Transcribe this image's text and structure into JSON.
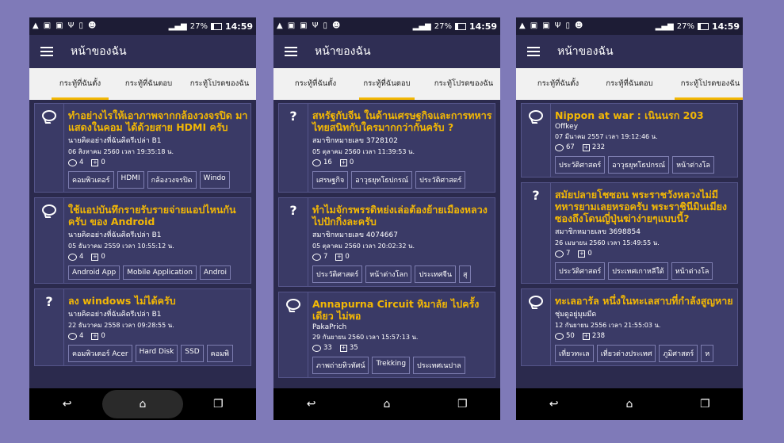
{
  "status": {
    "battery": "27%",
    "time": "14:59"
  },
  "app": {
    "title": "หน้าของฉัน"
  },
  "tabs": [
    "กระทู้ที่ฉันตั้ง",
    "กระทู้ที่ฉันตอบ",
    "กระทู้โปรดของฉัน"
  ],
  "phones": [
    {
      "active_tab": 0,
      "cards": [
        {
          "icon": "comment",
          "title": "ทำอย่างไรให้เอาภาพจากกล้องวงจรปิด มาแสดงในคอม ได้ด้วยสาย HDMI ครับ",
          "author": "นายคิดอย่างที่ฉันคิดรีเปล่า B1",
          "date": "06 สิงหาคม 2560 เวลา 19:35:18 น.",
          "comments": "4",
          "plus": "0",
          "tags": [
            "คอมพิวเตอร์",
            "HDMI",
            "กล้องวงจรปิด",
            "Windo"
          ]
        },
        {
          "icon": "comment",
          "title": "ใช้แอปบันทึกรายรับรายจ่ายแอปไหนกันครับ ของ Android",
          "author": "นายคิดอย่างที่ฉันคิดรีเปล่า B1",
          "date": "05 ธันวาคม 2559 เวลา 10:55:12 น.",
          "comments": "4",
          "plus": "0",
          "tags": [
            "Android App",
            "Mobile Application",
            "Androi"
          ]
        },
        {
          "icon": "question",
          "title": "ลง windows ไม่ได้ครับ",
          "author": "นายคิดอย่างที่ฉันคิดรีเปล่า B1",
          "date": "22 ธันวาคม 2558 เวลา 09:28:55 น.",
          "comments": "4",
          "plus": "0",
          "tags": [
            "คอมพิวเตอร์ Acer",
            "Hard Disk",
            "SSD",
            "คอมพิ"
          ]
        }
      ]
    },
    {
      "active_tab": 1,
      "cards": [
        {
          "icon": "question",
          "title": "สหรัฐกับจีน ในด้านเศรษฐกิจและการทหาร ไทยสนิทกับใครมากกว่ากันครับ ?",
          "author": "สมาชิกหมายเลข 3728102",
          "date": "05 ตุลาคม 2560 เวลา 11:39:53 น.",
          "comments": "16",
          "plus": "0",
          "tags": [
            "เศรษฐกิจ",
            "อาวุธยุทโธปกรณ์",
            "ประวัติศาสตร์"
          ]
        },
        {
          "icon": "question",
          "title": "ทำไมจักรพรรดิหย่งเล่อต้องย้ายเมืองหลวงไปปักกิ่งละครับ",
          "author": "สมาชิกหมายเลข 4074667",
          "date": "05 ตุลาคม 2560 เวลา 20:02:32 น.",
          "comments": "7",
          "plus": "0",
          "tags": [
            "ประวัติศาสตร์",
            "หน้าต่างโลก",
            "ประเทศจีน",
            "สุ"
          ]
        },
        {
          "icon": "comment",
          "title": "Annapurna Circuit หิมาลัย ไปครั้งเดียว ไม่พอ",
          "author": "PakaPrich",
          "date": "29 กันยายน 2560 เวลา 15:57:13 น.",
          "comments": "33",
          "plus": "35",
          "tags": [
            "ภาพถ่ายทิวทัศน์",
            "Trekking",
            "ประเทศเนปาล"
          ]
        }
      ]
    },
    {
      "active_tab": 2,
      "cards": [
        {
          "icon": "comment",
          "title": "Nippon at war : เนินนรก 203",
          "author": "Offkey",
          "date": "07 มีนาคม 2557 เวลา 19:12:46 น.",
          "comments": "67",
          "plus": "232",
          "tags": [
            "ประวัติศาสตร์",
            "อาวุธยุทโธปกรณ์",
            "หน้าต่างโล"
          ]
        },
        {
          "icon": "question",
          "title": "สมัยปลายโชซอน พระราชวังหลวงไม่มีทหารยามเลยหรอครับ พระราชินีมินเมียงซองถึงโดนญี่ปุ่นฆ่าง่ายๆแบบนี้?",
          "author": "สมาชิกหมายเลข 3698854",
          "date": "26 เมษายน 2560 เวลา 15:49:55 น.",
          "comments": "7",
          "plus": "0",
          "tags": [
            "ประวัติศาสตร์",
            "ประเทศเกาหลีใต้",
            "หน้าต่างโล"
          ]
        },
        {
          "icon": "comment",
          "title": "ทะเลอารัล หนึ่งในทะเลสาบที่กำลังสูญหาย",
          "author": "ชุ่มดูอยู่มุมมืด",
          "date": "12 กันยายน 2556 เวลา 21:55:03 น.",
          "comments": "50",
          "plus": "238",
          "tags": [
            "เที่ยวทะเล",
            "เที่ยวต่างประเทศ",
            "ภูมิศาสตร์",
            "ห"
          ]
        }
      ]
    }
  ],
  "nav": {
    "back": "↩",
    "home": "⌂",
    "recent": "❐"
  }
}
